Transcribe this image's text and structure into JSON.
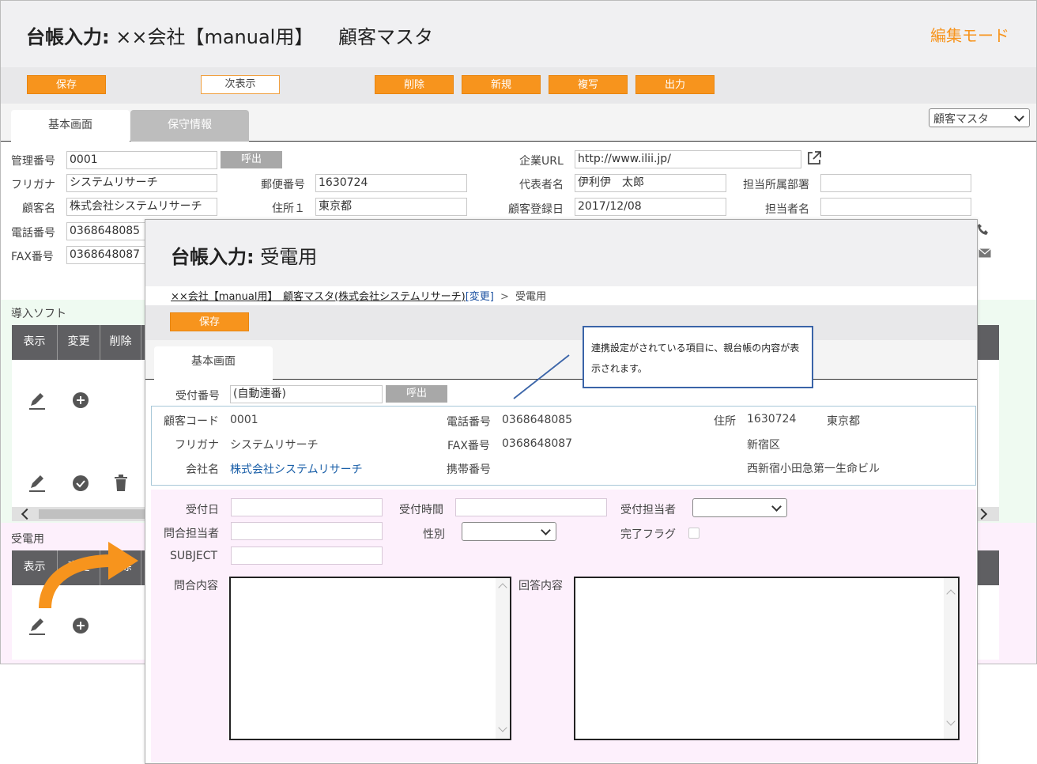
{
  "bg": {
    "title_prefix": "台帳入力:",
    "title_company": "××会社【manual用】",
    "title_master": "顧客マスタ",
    "edit_mode": "編集モード",
    "toolbar": {
      "save": "保存",
      "next": "次表示",
      "delete": "削除",
      "new": "新規",
      "copy": "複写",
      "output": "出力"
    },
    "tabs": [
      "基本画面",
      "保守情報"
    ],
    "master_select": "顧客マスタ",
    "form": {
      "mgmt_no_label": "管理番号",
      "mgmt_no": "0001",
      "call_btn": "呼出",
      "kana_label": "フリガナ",
      "kana": "システムリサーチ",
      "name_label": "顧客名",
      "name": "株式会社システムリサーチ",
      "tel_label": "電話番号",
      "tel": "0368648085",
      "fax_label": "FAX番号",
      "fax": "0368648087",
      "zip_label": "郵便番号",
      "zip": "1630724",
      "addr_label": "住所１",
      "addr": "東京都",
      "url_label": "企業URL",
      "url": "http://www.ilii.jp/",
      "rep_label": "代表者名",
      "rep": "伊利伊　太郎",
      "reg_label": "顧客登録日",
      "reg": "2017/12/08",
      "dept_label": "担当所属部署",
      "dept": "",
      "person_label": "担当者名",
      "person": ""
    },
    "software_section": "導入ソフト",
    "reception_section": "受電用",
    "table_headers": [
      "表示",
      "変更",
      "削除"
    ]
  },
  "fg": {
    "title_prefix": "台帳入力:",
    "title_name": "受電用",
    "breadcrumb": {
      "link": "××会社【manual用】　顧客マスタ(株式会社システムリサーチ)",
      "change": "[変更]",
      "sep": ">",
      "current": "受電用"
    },
    "save": "保存",
    "tab": "基本画面",
    "callout": "連携設定がされている項目に、親台帳の内容が表示されます。",
    "receipt_no_label": "受付番号",
    "receipt_no": "(自動連番)",
    "call_btn": "呼出",
    "linked": {
      "code_label": "顧客コード",
      "code": "0001",
      "kana_label": "フリガナ",
      "kana": "システムリサーチ",
      "company_label": "会社名",
      "company": "株式会社システムリサーチ",
      "tel_label": "電話番号",
      "tel": "0368648085",
      "fax_label": "FAX番号",
      "fax": "0368648087",
      "mobile_label": "携帯番号",
      "mobile": "",
      "addr_label": "住所",
      "zip": "1630724",
      "addr1": "東京都",
      "addr2": "新宿区",
      "addr3": "西新宿小田急第一生命ビル"
    },
    "reception": {
      "date_label": "受付日",
      "time_label": "受付時間",
      "staff_label": "受付担当者",
      "inquirer_label": "問合担当者",
      "gender_label": "性別",
      "done_label": "完了フラグ",
      "subject_label": "SUBJECT",
      "inquiry_label": "問合内容",
      "answer_label": "回答内容"
    }
  }
}
